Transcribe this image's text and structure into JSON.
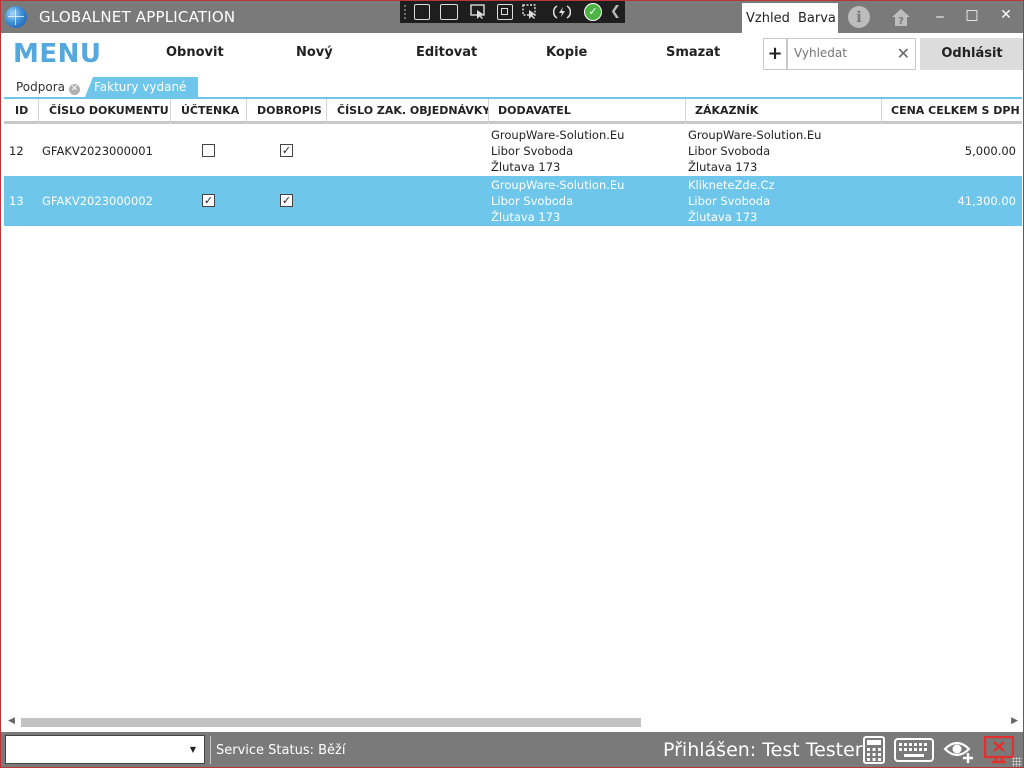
{
  "window": {
    "title": "GLOBALNET APPLICATION"
  },
  "titlebar": {
    "tabs": [
      "Vzhled",
      "Barva"
    ],
    "info_icon": "info-icon",
    "home_icon": "home-question-icon",
    "minimize": "‒",
    "maximize": "□",
    "close": "✕"
  },
  "menu": {
    "label": "MENU",
    "buttons": [
      "Obnovit",
      "Nový",
      "Editovat",
      "Kopie",
      "Smazat"
    ],
    "plus": "+",
    "search_placeholder": "Vyhledat",
    "search_clear": "✕",
    "logout": "Odhlásit"
  },
  "doc_tabs": [
    {
      "label": "Podpora",
      "active": false
    },
    {
      "label": "Faktury vydané",
      "active": true
    }
  ],
  "grid": {
    "columns": [
      "ID",
      "ČÍSLO DOKUMENTU",
      "ÚČTENKA",
      "DOBROPIS",
      "ČÍSLO ZAK. OBJEDNÁVKY",
      "DODAVATEL",
      "ZÁKAZNÍK",
      "CENA CELKEM S DPH"
    ],
    "rows": [
      {
        "id": "12",
        "doc_number": "GFAKV2023000001",
        "uctenka": false,
        "dobropis": true,
        "order_number": "",
        "supplier": [
          "GroupWare-Solution.Eu",
          "Libor Svoboda",
          "Žlutava 173"
        ],
        "customer": [
          "GroupWare-Solution.Eu",
          "Libor Svoboda",
          "Žlutava 173"
        ],
        "total": "5,000.00",
        "selected": false
      },
      {
        "id": "13",
        "doc_number": "GFAKV2023000002",
        "uctenka": true,
        "dobropis": true,
        "order_number": "",
        "supplier": [
          "GroupWare-Solution.Eu",
          "Libor Svoboda",
          "Žlutava 173"
        ],
        "customer": [
          "KlikneteZde.Cz",
          "Libor Svoboda",
          "Žlutava 173"
        ],
        "total": "41,300.00",
        "selected": true
      }
    ]
  },
  "status": {
    "combo_value": "",
    "service_label": "Service Status:",
    "service_value": "Běží",
    "logged_in": "Přihlášen: Test Tester",
    "icons": [
      "calculator-icon",
      "keyboard-icon",
      "eye-add-icon",
      "remote-desktop-icon"
    ]
  },
  "colors": {
    "titlebar": "#7a7a7a",
    "accent": "#6ec6ea",
    "menu_label": "#54a8de",
    "border": "#b9353a",
    "remote_icon": "#e0302f"
  }
}
